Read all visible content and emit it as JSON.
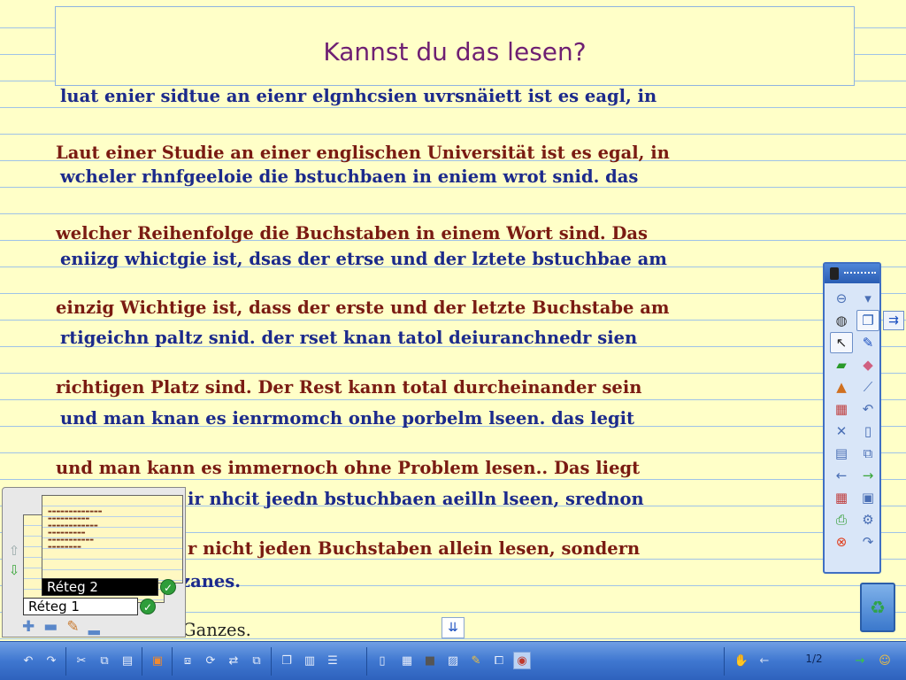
{
  "title": "Kannst du das lesen?",
  "lines": [
    {
      "kind": "scrambled",
      "text": "luat enier sidtue an eienr elgnhcsien uvrsnäiett ist es eagl, in"
    },
    {
      "kind": "correct",
      "text": "Laut einer Studie an einer englischen Universität ist es egal, in"
    },
    {
      "kind": "scrambled",
      "text": "wcheler rhnfgeeloie die bstuchbaen in eniem wrot snid. das"
    },
    {
      "kind": "correct",
      "text": "welcher Reihenfolge die Buchstaben in einem Wort sind. Das"
    },
    {
      "kind": "scrambled",
      "text": "eniizg whictgie ist, dsas der etrse und der lztete bstuchbae am"
    },
    {
      "kind": "correct",
      "text": "einzig Wichtige ist, dass der erste und der letzte Buchstabe am"
    },
    {
      "kind": "scrambled",
      "text": "rtigeichn paltz snid. der rset knan tatol deiuranchnedr sien"
    },
    {
      "kind": "correct",
      "text": "richtigen Platz sind. Der Rest kann total durcheinander sein"
    },
    {
      "kind": "scrambled",
      "text": "und man knan es ienrmomch onhe porbelm lseen. das legit"
    },
    {
      "kind": "correct",
      "text": "und man kann es immernoch ohne Problem lesen.. Das liegt"
    },
    {
      "kind": "scrambled",
      "text": "ir nhcit jeedn bstuchbaen aeilln lseen, srednon"
    },
    {
      "kind": "correct",
      "text": "r nicht jeden Buchstaben allein lesen, sondern"
    },
    {
      "kind": "scrambled",
      "text": "zanes."
    },
    {
      "kind": "correct",
      "text": "Ganzes."
    }
  ],
  "layers": {
    "layer2": "Réteg 2",
    "layer1": "Réteg 1"
  },
  "page_indicator": "1/2",
  "tool_icons": [
    "zoom-out-icon",
    "dropdown-icon",
    "mouse-icon",
    "copy-page-icon",
    "select-arrow-icon",
    "pen-icon",
    "highlighter-icon",
    "eraser-icon",
    "shapes-icon",
    "line-icon",
    "add-object-icon",
    "undo-icon",
    "delete-icon",
    "new-page-icon",
    "page-icon",
    "duplicate-icon",
    "back-icon",
    "forward-icon",
    "grid-icon",
    "save-icon",
    "print-icon",
    "tools-icon",
    "close-icon",
    "redo-icon"
  ],
  "accent_colors": {
    "title": "#6e1f72",
    "scrambled_text": "#1c2a8c",
    "correct_text": "#7a1b12",
    "toolbar": "#3f77d0"
  }
}
